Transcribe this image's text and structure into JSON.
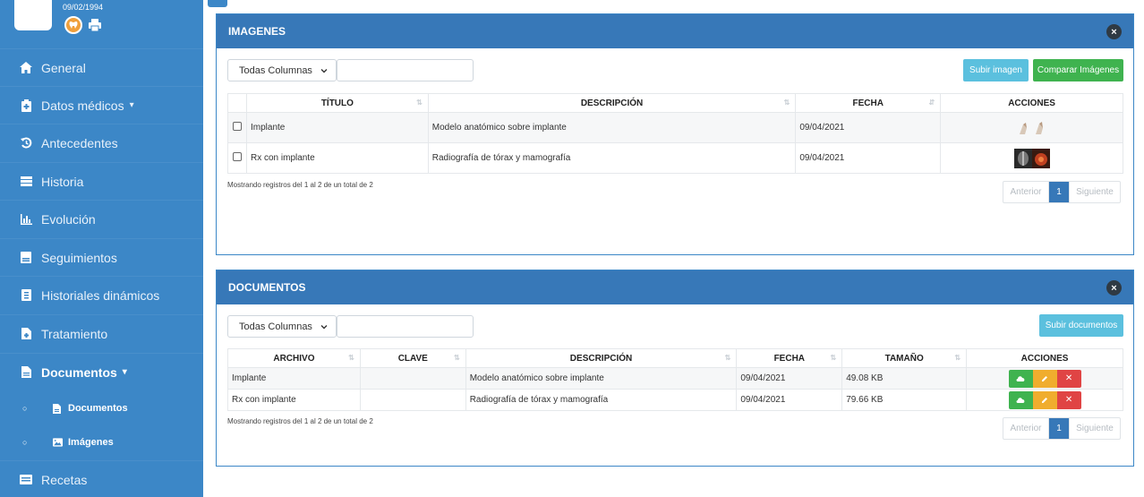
{
  "sidebar": {
    "dob": "09/02/1994",
    "items": [
      {
        "label": "General",
        "icon": "home-icon"
      },
      {
        "label": "Datos médicos",
        "icon": "briefcase-medical-icon",
        "caret": "▾"
      },
      {
        "label": "Antecedentes",
        "icon": "history-icon"
      },
      {
        "label": "Historia",
        "icon": "list-icon"
      },
      {
        "label": "Evolución",
        "icon": "bar-chart-icon"
      },
      {
        "label": "Seguimientos",
        "icon": "clipboard-icon"
      },
      {
        "label": "Historiales dinámicos",
        "icon": "file-icon"
      },
      {
        "label": "Tratamiento",
        "icon": "file-medical-icon"
      },
      {
        "label": "Documentos",
        "icon": "document-icon",
        "caret": "▾"
      },
      {
        "label": "Recetas",
        "icon": "receipt-icon"
      }
    ],
    "subitems": [
      {
        "bullet": "○",
        "label": "Documentos",
        "icon": "document-icon"
      },
      {
        "bullet": "○",
        "label": "Imágenes",
        "icon": "image-icon"
      }
    ]
  },
  "images_panel": {
    "title": "IMAGENES",
    "filter_select": "Todas Columnas",
    "upload_label": "Subir imagen",
    "compare_label": "Comparar Imágenes",
    "columns": [
      "TÍTULO",
      "DESCRIPCIÓN",
      "FECHA",
      "ACCIONES"
    ],
    "rows": [
      {
        "title": "Implante",
        "description": "Modelo anatómico sobre implante",
        "date": "09/04/2021"
      },
      {
        "title": "Rx con implante",
        "description": "Radiografía de tórax y mamografía",
        "date": "09/04/2021"
      }
    ],
    "info": "Mostrando registros del 1 al 2 de un total de 2",
    "pager": {
      "prev": "Anterior",
      "page": "1",
      "next": "Siguiente"
    }
  },
  "documents_panel": {
    "title": "DOCUMENTOS",
    "filter_select": "Todas Columnas",
    "upload_label": "Subir documentos",
    "columns": [
      "ARCHIVO",
      "CLAVE",
      "DESCRIPCIÓN",
      "FECHA",
      "TAMAÑO",
      "ACCIONES"
    ],
    "rows": [
      {
        "file": "Implante",
        "key": "",
        "description": "Modelo anatómico sobre implante",
        "date": "09/04/2021",
        "size": "49.08 KB"
      },
      {
        "file": "Rx con implante",
        "key": "",
        "description": "Radiografía de tórax y mamografía",
        "date": "09/04/2021",
        "size": "79.66 KB"
      }
    ],
    "info": "Mostrando registros del 1 al 2 de un total de 2",
    "pager": {
      "prev": "Anterior",
      "page": "1",
      "next": "Siguiente"
    }
  },
  "colors": {
    "sidebar": "#3c87c7",
    "panel_header": "#3778b8",
    "success": "#3fb34f",
    "info": "#5bc0de",
    "warning": "#f0ad2e",
    "danger": "#e04444"
  }
}
